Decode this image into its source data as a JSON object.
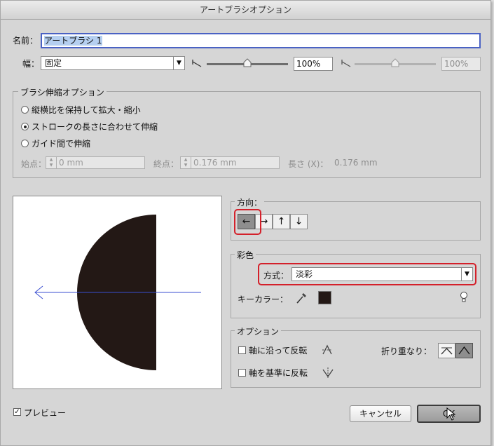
{
  "window": {
    "title": "アートブラシオプション"
  },
  "name": {
    "label": "名前：",
    "value": "アートブラシ 1"
  },
  "width": {
    "label": "幅：",
    "mode": "固定",
    "min_value": "100%",
    "max_value": "100%"
  },
  "scale_options": {
    "title": "ブラシ伸縮オプション",
    "options": [
      {
        "label": "縦横比を保持して拡大・縮小",
        "selected": false
      },
      {
        "label": "ストロークの長さに合わせて伸縮",
        "selected": true
      },
      {
        "label": "ガイド間で伸縮",
        "selected": false
      }
    ],
    "start_label": "始点：",
    "start_value": "0 mm",
    "end_label": "終点：",
    "end_value": "0.176 mm",
    "length_label": "長さ (X)：",
    "length_value": "0.176 mm"
  },
  "direction": {
    "title": "方向：",
    "buttons": [
      {
        "glyph": "←",
        "active": true
      },
      {
        "glyph": "→",
        "active": false
      },
      {
        "glyph": "↑",
        "active": false
      },
      {
        "glyph": "↓",
        "active": false
      }
    ]
  },
  "colorization": {
    "title": "彩色",
    "method_label": "方式：",
    "method_value": "淡彩",
    "key_color_label": "キーカラー：",
    "key_color": "#231815"
  },
  "options": {
    "title": "オプション",
    "flip_along_label": "軸に沿って反転",
    "flip_along_checked": false,
    "flip_across_label": "軸を基準に反転",
    "flip_across_checked": false,
    "overlap_label": "折り重なり："
  },
  "preview": {
    "label": "プレビュー",
    "checked": true
  },
  "buttons": {
    "cancel": "キャンセル",
    "ok": "OK"
  },
  "colors": {
    "accent": "#4a62c4",
    "highlight": "#d4202a",
    "stroke_line": "#3a4ed0"
  }
}
